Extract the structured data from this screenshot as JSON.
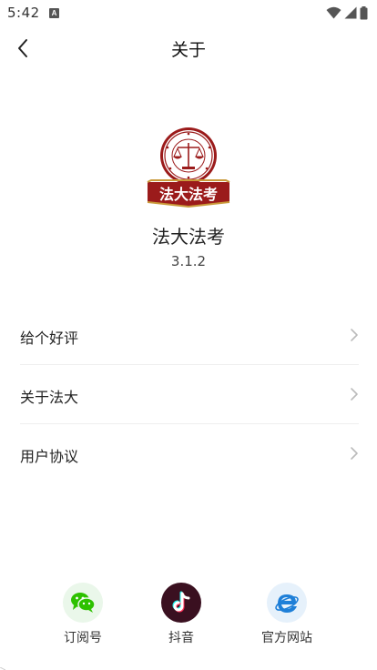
{
  "status_bar": {
    "time": "5:42",
    "notification_badge": "A"
  },
  "nav": {
    "title": "关于"
  },
  "app": {
    "logo_text": "法大法考",
    "name": "法大法考",
    "version": "3.1.2"
  },
  "menu": {
    "items": [
      {
        "label": "给个好评"
      },
      {
        "label": "关于法大"
      },
      {
        "label": "用户协议"
      }
    ]
  },
  "footer": {
    "items": [
      {
        "label": "订阅号",
        "icon": "wechat-icon",
        "color": "#2dc100",
        "bg": "#eaf7ea"
      },
      {
        "label": "抖音",
        "icon": "douyin-icon",
        "color": "#ffffff",
        "bg": "#3a1020"
      },
      {
        "label": "官方网站",
        "icon": "ie-browser-icon",
        "color": "#1e7fd8",
        "bg": "#e6f1fb"
      }
    ]
  },
  "colors": {
    "logo_red": "#9b1b1b",
    "logo_gold": "#c99a3a"
  }
}
